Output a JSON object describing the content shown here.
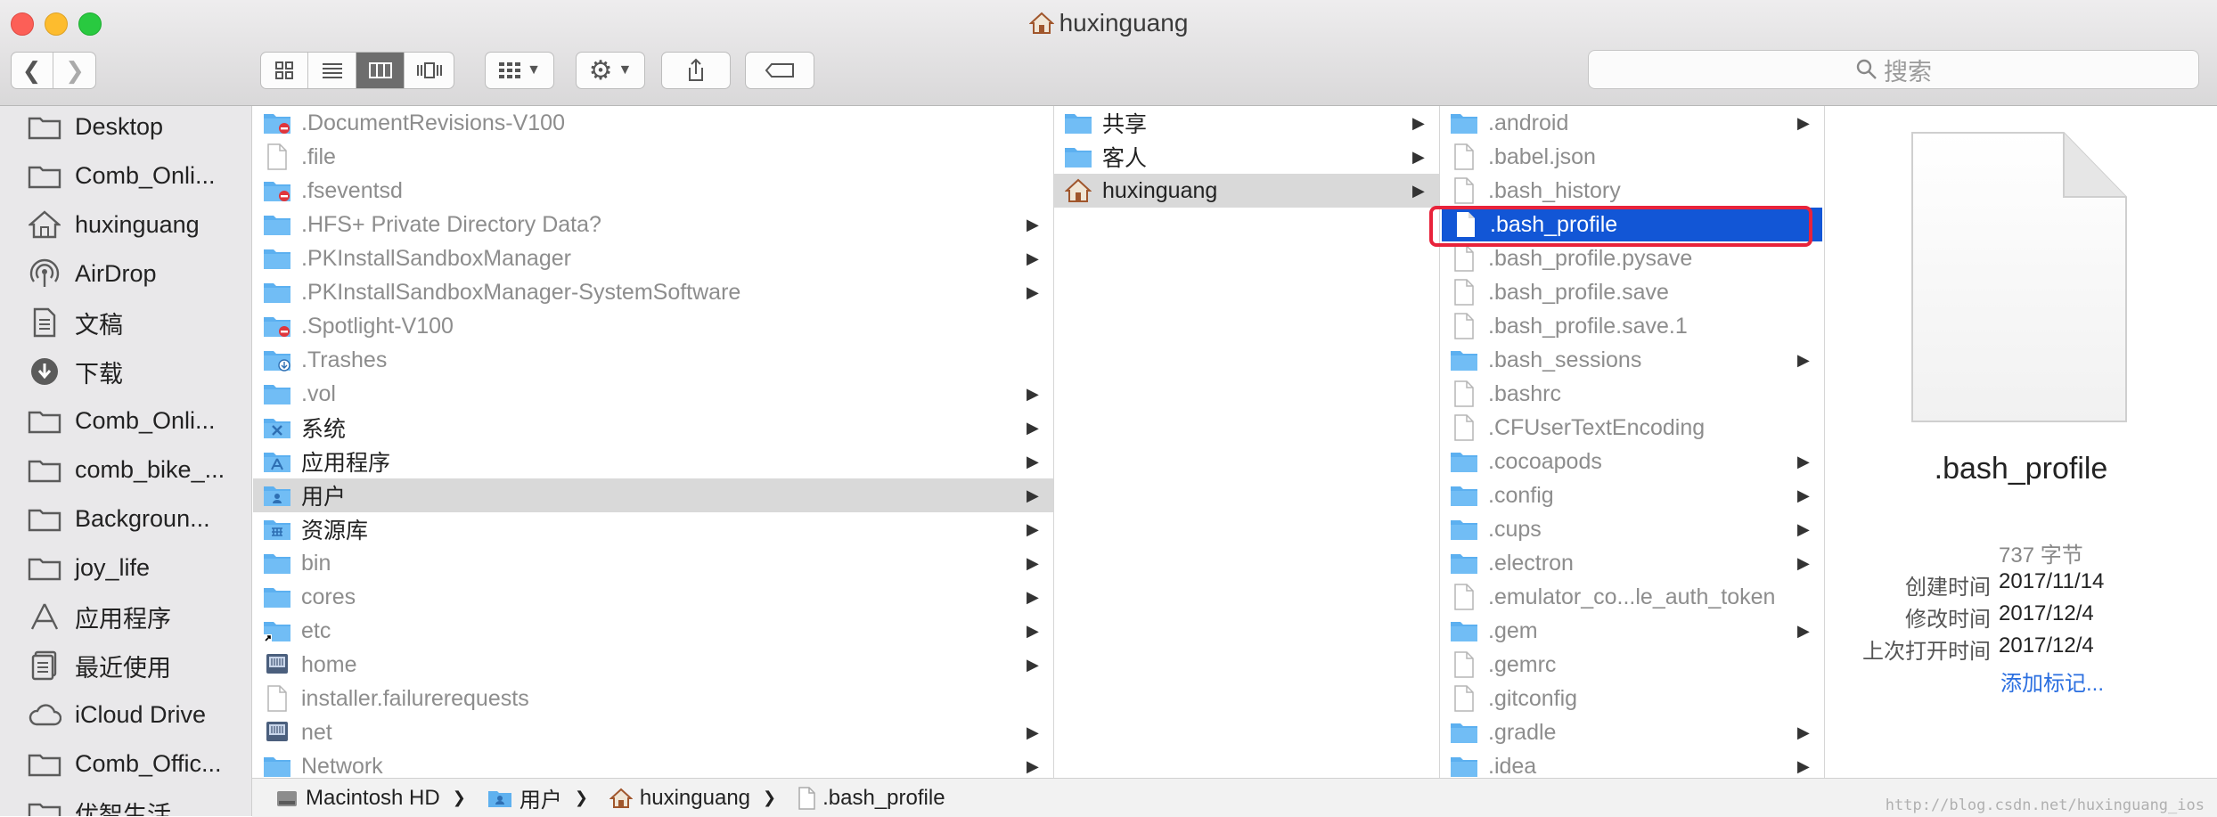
{
  "window": {
    "title": "huxinguang"
  },
  "toolbar": {
    "search_placeholder": "搜索"
  },
  "sidebar": {
    "items": [
      {
        "label": "Desktop",
        "icon": "folder-icon"
      },
      {
        "label": "Comb_Onli...",
        "icon": "folder-icon"
      },
      {
        "label": "huxinguang",
        "icon": "home-icon"
      },
      {
        "label": "AirDrop",
        "icon": "airdrop-icon"
      },
      {
        "label": "文稿",
        "icon": "document-icon"
      },
      {
        "label": "下载",
        "icon": "download-icon"
      },
      {
        "label": "Comb_Onli...",
        "icon": "folder-icon"
      },
      {
        "label": "comb_bike_...",
        "icon": "folder-icon"
      },
      {
        "label": "Backgroun...",
        "icon": "folder-icon"
      },
      {
        "label": "joy_life",
        "icon": "folder-icon"
      },
      {
        "label": "应用程序",
        "icon": "applications-icon"
      },
      {
        "label": "最近使用",
        "icon": "recents-icon"
      },
      {
        "label": "iCloud Drive",
        "icon": "cloud-icon"
      },
      {
        "label": "Comb_Offic...",
        "icon": "folder-icon"
      },
      {
        "label": "优智生活",
        "icon": "folder-icon"
      }
    ]
  },
  "column1": {
    "rows": [
      {
        "label": ".DocumentRevisions-V100",
        "icon": "restricted-folder-icon",
        "dim": true,
        "arrow": false
      },
      {
        "label": ".file",
        "icon": "file-icon",
        "dim": true,
        "arrow": false
      },
      {
        "label": ".fseventsd",
        "icon": "restricted-folder-icon",
        "dim": true,
        "arrow": false
      },
      {
        "label": ".HFS+ Private Directory Data?",
        "icon": "folder-icon",
        "dim": true,
        "arrow": true
      },
      {
        "label": ".PKInstallSandboxManager",
        "icon": "folder-icon",
        "dim": true,
        "arrow": true
      },
      {
        "label": ".PKInstallSandboxManager-SystemSoftware",
        "icon": "folder-icon",
        "dim": true,
        "arrow": true
      },
      {
        "label": ".Spotlight-V100",
        "icon": "restricted-folder-icon",
        "dim": true,
        "arrow": false
      },
      {
        "label": ".Trashes",
        "icon": "dropbox-folder-icon",
        "dim": true,
        "arrow": false
      },
      {
        "label": ".vol",
        "icon": "folder-icon",
        "dim": true,
        "arrow": true
      },
      {
        "label": "系统",
        "icon": "system-folder-icon",
        "dim": false,
        "arrow": true
      },
      {
        "label": "应用程序",
        "icon": "applications-folder-icon",
        "dim": false,
        "arrow": true
      },
      {
        "label": "用户",
        "icon": "users-folder-icon",
        "dim": false,
        "arrow": true,
        "selected": true
      },
      {
        "label": "资源库",
        "icon": "library-folder-icon",
        "dim": false,
        "arrow": true
      },
      {
        "label": "bin",
        "icon": "folder-icon",
        "dim": true,
        "arrow": true
      },
      {
        "label": "cores",
        "icon": "folder-icon",
        "dim": true,
        "arrow": true
      },
      {
        "label": "etc",
        "icon": "alias-folder-icon",
        "dim": true,
        "arrow": true
      },
      {
        "label": "home",
        "icon": "network-drive-icon",
        "dim": true,
        "arrow": true
      },
      {
        "label": "installer.failurerequests",
        "icon": "file-icon",
        "dim": true,
        "arrow": false
      },
      {
        "label": "net",
        "icon": "network-drive-icon",
        "dim": true,
        "arrow": true
      },
      {
        "label": "Network",
        "icon": "folder-icon",
        "dim": true,
        "arrow": true
      }
    ]
  },
  "column2": {
    "rows": [
      {
        "label": "共享",
        "icon": "folder-icon",
        "arrow": true
      },
      {
        "label": "客人",
        "icon": "folder-icon",
        "arrow": true
      },
      {
        "label": "huxinguang",
        "icon": "home-icon",
        "arrow": true,
        "selected": true
      }
    ]
  },
  "column3": {
    "rows": [
      {
        "label": ".android",
        "icon": "folder-icon",
        "arrow": true
      },
      {
        "label": ".babel.json",
        "icon": "file-icon",
        "arrow": false
      },
      {
        "label": ".bash_history",
        "icon": "file-icon",
        "arrow": false
      },
      {
        "label": ".bash_profile",
        "icon": "file-icon",
        "arrow": false,
        "selected": true
      },
      {
        "label": ".bash_profile.pysave",
        "icon": "file-icon",
        "arrow": false
      },
      {
        "label": ".bash_profile.save",
        "icon": "file-icon",
        "arrow": false
      },
      {
        "label": ".bash_profile.save.1",
        "icon": "file-icon",
        "arrow": false
      },
      {
        "label": ".bash_sessions",
        "icon": "folder-icon",
        "arrow": true
      },
      {
        "label": ".bashrc",
        "icon": "file-icon",
        "arrow": false
      },
      {
        "label": ".CFUserTextEncoding",
        "icon": "file-icon",
        "arrow": false
      },
      {
        "label": ".cocoapods",
        "icon": "folder-icon",
        "arrow": true
      },
      {
        "label": ".config",
        "icon": "folder-icon",
        "arrow": true
      },
      {
        "label": ".cups",
        "icon": "folder-icon",
        "arrow": true
      },
      {
        "label": ".electron",
        "icon": "folder-icon",
        "arrow": true
      },
      {
        "label": ".emulator_co...le_auth_token",
        "icon": "file-icon",
        "arrow": false
      },
      {
        "label": ".gem",
        "icon": "folder-icon",
        "arrow": true
      },
      {
        "label": ".gemrc",
        "icon": "file-icon",
        "arrow": false
      },
      {
        "label": ".gitconfig",
        "icon": "file-icon",
        "arrow": false
      },
      {
        "label": ".gradle",
        "icon": "folder-icon",
        "arrow": true
      },
      {
        "label": ".idea",
        "icon": "folder-icon",
        "arrow": true
      }
    ]
  },
  "preview": {
    "filename": ".bash_profile",
    "size": "737 字节",
    "created_label": "创建时间",
    "created_value": "2017/11/14",
    "modified_label": "修改时间",
    "modified_value": "2017/12/4",
    "opened_label": "上次打开时间",
    "opened_value": "2017/12/4",
    "add_tags": "添加标记..."
  },
  "pathbar": {
    "segments": [
      {
        "label": "Macintosh HD",
        "icon": "hard-drive-icon"
      },
      {
        "label": "用户",
        "icon": "users-folder-icon"
      },
      {
        "label": "huxinguang",
        "icon": "home-icon"
      },
      {
        "label": ".bash_profile",
        "icon": "file-icon"
      }
    ]
  },
  "watermark": "http://blog.csdn.net/huxinguang_ios"
}
